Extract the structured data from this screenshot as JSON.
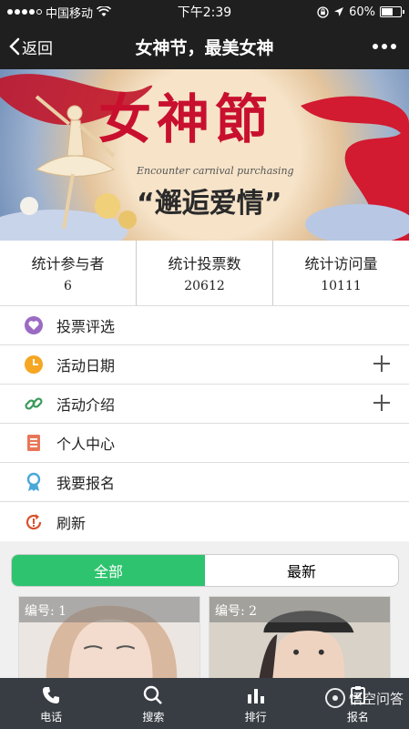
{
  "status_bar": {
    "carrier": "中国移动",
    "time": "下午2:39",
    "battery_percent": "60%",
    "battery_level": 0.6,
    "signal_icon": "signal-dots-icon",
    "wifi_icon": "wifi-icon",
    "lock_icon": "rotation-lock-icon",
    "location_icon": "location-arrow-icon"
  },
  "nav": {
    "back_label": "返回",
    "title": "女神节，最美女神",
    "more_icon": "more-dots-icon"
  },
  "banner": {
    "title": "女神節",
    "subtitle": "Encounter carnival purchasing",
    "slogan": "“邂逅爱情”"
  },
  "stats": [
    {
      "label": "统计参与者",
      "value": "6"
    },
    {
      "label": "统计投票数",
      "value": "20612"
    },
    {
      "label": "统计访问量",
      "value": "10111"
    }
  ],
  "menu": [
    {
      "label": "投票评选",
      "icon": "heart-icon",
      "color": "#9b6bc4",
      "expandable": false
    },
    {
      "label": "活动日期",
      "icon": "clock-icon",
      "color": "#f5a623",
      "expandable": true
    },
    {
      "label": "活动介绍",
      "icon": "link-icon",
      "color": "#3a9a5b",
      "expandable": true
    },
    {
      "label": "个人中心",
      "icon": "document-icon",
      "color": "#e8775a",
      "expandable": false
    },
    {
      "label": "我要报名",
      "icon": "award-ribbon-icon",
      "color": "#4aa8d8",
      "expandable": false
    },
    {
      "label": "刷新",
      "icon": "refresh-icon",
      "color": "#d9512c",
      "expandable": false
    }
  ],
  "tabs": [
    {
      "label": "全部",
      "active": true
    },
    {
      "label": "最新",
      "active": false
    }
  ],
  "cards": [
    {
      "badge": "编号: 1"
    },
    {
      "badge": "编号: 2"
    }
  ],
  "bottom_bar": [
    {
      "label": "电话",
      "icon": "phone-icon"
    },
    {
      "label": "搜索",
      "icon": "search-icon"
    },
    {
      "label": "排行",
      "icon": "bar-chart-icon"
    },
    {
      "label": "报名",
      "icon": "clipboard-icon"
    }
  ],
  "watermark": "悟空问答",
  "colors": {
    "accent_green": "#2ec36e",
    "bar_dark": "#1f1f1f",
    "bottom_bar": "#383d44",
    "banner_red": "#c8102e"
  }
}
